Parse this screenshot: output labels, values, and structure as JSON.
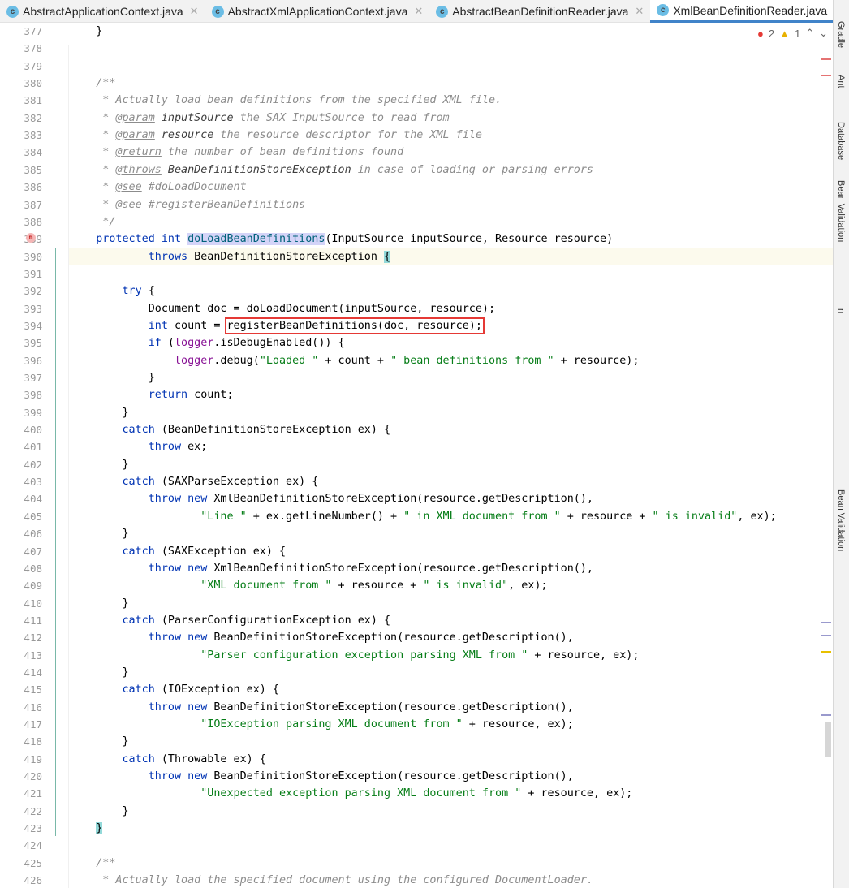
{
  "tabs": [
    {
      "label": "AbstractApplicationContext.java",
      "active": false
    },
    {
      "label": "AbstractXmlApplicationContext.java",
      "active": false
    },
    {
      "label": "AbstractBeanDefinitionReader.java",
      "active": false
    },
    {
      "label": "XmlBeanDefinitionReader.java",
      "active": true
    }
  ],
  "inspections": {
    "errors": "2",
    "warnings": "1"
  },
  "tool_windows": [
    "Gradle",
    "Ant",
    "Database",
    "Bean Validation",
    "n",
    "Bean Validation"
  ],
  "colors": {
    "keyword": "#0033b3",
    "string": "#067d17",
    "comment": "#8c8c8c",
    "field": "#871094",
    "highlight_box": "#e53935"
  },
  "current_line": 390,
  "boxed_line": 394,
  "lines": [
    {
      "n": "377",
      "t": [
        [
          "p",
          "    }"
        ]
      ]
    },
    {
      "n": "378",
      "t": []
    },
    {
      "n": "379",
      "t": []
    },
    {
      "n": "380",
      "t": [
        [
          "c",
          "    /**"
        ]
      ]
    },
    {
      "n": "381",
      "t": [
        [
          "c",
          "     * Actually load bean definitions from the specified XML file."
        ]
      ]
    },
    {
      "n": "382",
      "t": [
        [
          "c",
          "     * "
        ],
        [
          "ct",
          "@param"
        ],
        [
          "cb",
          " inputSource"
        ],
        [
          "c",
          " the SAX InputSource to read from"
        ]
      ]
    },
    {
      "n": "383",
      "t": [
        [
          "c",
          "     * "
        ],
        [
          "ct",
          "@param"
        ],
        [
          "cb",
          " resource"
        ],
        [
          "c",
          " the resource descriptor for the XML file"
        ]
      ]
    },
    {
      "n": "384",
      "t": [
        [
          "c",
          "     * "
        ],
        [
          "ct",
          "@return"
        ],
        [
          "c",
          " the number of bean definitions found"
        ]
      ]
    },
    {
      "n": "385",
      "t": [
        [
          "c",
          "     * "
        ],
        [
          "ct",
          "@throws"
        ],
        [
          "cb",
          " BeanDefinitionStoreException"
        ],
        [
          "c",
          " in case of loading or parsing errors"
        ]
      ]
    },
    {
      "n": "386",
      "t": [
        [
          "c",
          "     * "
        ],
        [
          "ct",
          "@see"
        ],
        [
          "c",
          " #doLoadDocument"
        ]
      ]
    },
    {
      "n": "387",
      "t": [
        [
          "c",
          "     * "
        ],
        [
          "ct",
          "@see"
        ],
        [
          "c",
          " #registerBeanDefinitions"
        ]
      ]
    },
    {
      "n": "388",
      "t": [
        [
          "c",
          "     */"
        ]
      ]
    },
    {
      "n": "389",
      "t": [
        [
          "k",
          "    protected int "
        ],
        [
          "m",
          "doLoadBeanDefinitions"
        ],
        [
          "p",
          "(InputSource inputSource, Resource resource)"
        ]
      ]
    },
    {
      "n": "390",
      "t": [
        [
          "k",
          "            throws"
        ],
        [
          "p",
          " BeanDefinitionStoreException "
        ],
        [
          "br",
          "{"
        ]
      ]
    },
    {
      "n": "391",
      "t": []
    },
    {
      "n": "392",
      "t": [
        [
          "k",
          "        try"
        ],
        [
          "p",
          " {"
        ]
      ]
    },
    {
      "n": "393",
      "t": [
        [
          "p",
          "            Document doc = doLoadDocument(inputSource, resource);"
        ]
      ]
    },
    {
      "n": "394",
      "t": [
        [
          "k",
          "            int"
        ],
        [
          "p",
          " count = "
        ],
        [
          "x",
          "registerBeanDefinitions(doc, resource);"
        ]
      ]
    },
    {
      "n": "395",
      "t": [
        [
          "k",
          "            if"
        ],
        [
          "p",
          " ("
        ],
        [
          "f",
          "logger"
        ],
        [
          "p",
          ".isDebugEnabled()) {"
        ]
      ]
    },
    {
      "n": "396",
      "t": [
        [
          "f",
          "                logger"
        ],
        [
          "p",
          ".debug("
        ],
        [
          "s",
          "\"Loaded \""
        ],
        [
          "p",
          " + count + "
        ],
        [
          "s",
          "\" bean definitions from \""
        ],
        [
          "p",
          " + resource);"
        ]
      ]
    },
    {
      "n": "397",
      "t": [
        [
          "p",
          "            }"
        ]
      ]
    },
    {
      "n": "398",
      "t": [
        [
          "k",
          "            return"
        ],
        [
          "p",
          " count;"
        ]
      ]
    },
    {
      "n": "399",
      "t": [
        [
          "p",
          "        }"
        ]
      ]
    },
    {
      "n": "400",
      "t": [
        [
          "k",
          "        catch"
        ],
        [
          "p",
          " (BeanDefinitionStoreException ex) {"
        ]
      ]
    },
    {
      "n": "401",
      "t": [
        [
          "k",
          "            throw"
        ],
        [
          "p",
          " ex;"
        ]
      ]
    },
    {
      "n": "402",
      "t": [
        [
          "p",
          "        }"
        ]
      ]
    },
    {
      "n": "403",
      "t": [
        [
          "k",
          "        catch"
        ],
        [
          "p",
          " (SAXParseException ex) {"
        ]
      ]
    },
    {
      "n": "404",
      "t": [
        [
          "k",
          "            throw new"
        ],
        [
          "p",
          " XmlBeanDefinitionStoreException(resource.getDescription(),"
        ]
      ]
    },
    {
      "n": "405",
      "t": [
        [
          "s",
          "                    \"Line \""
        ],
        [
          "p",
          " + ex.getLineNumber() + "
        ],
        [
          "s",
          "\" in XML document from \""
        ],
        [
          "p",
          " + resource + "
        ],
        [
          "s",
          "\" is invalid\""
        ],
        [
          "p",
          ", ex);"
        ]
      ]
    },
    {
      "n": "406",
      "t": [
        [
          "p",
          "        }"
        ]
      ]
    },
    {
      "n": "407",
      "t": [
        [
          "k",
          "        catch"
        ],
        [
          "p",
          " (SAXException ex) {"
        ]
      ]
    },
    {
      "n": "408",
      "t": [
        [
          "k",
          "            throw new"
        ],
        [
          "p",
          " XmlBeanDefinitionStoreException(resource.getDescription(),"
        ]
      ]
    },
    {
      "n": "409",
      "t": [
        [
          "s",
          "                    \"XML document from \""
        ],
        [
          "p",
          " + resource + "
        ],
        [
          "s",
          "\" is invalid\""
        ],
        [
          "p",
          ", ex);"
        ]
      ]
    },
    {
      "n": "410",
      "t": [
        [
          "p",
          "        }"
        ]
      ]
    },
    {
      "n": "411",
      "t": [
        [
          "k",
          "        catch"
        ],
        [
          "p",
          " (ParserConfigurationException ex) {"
        ]
      ]
    },
    {
      "n": "412",
      "t": [
        [
          "k",
          "            throw new"
        ],
        [
          "p",
          " BeanDefinitionStoreException(resource.getDescription(),"
        ]
      ]
    },
    {
      "n": "413",
      "t": [
        [
          "s",
          "                    \"Parser configuration exception parsing XML from \""
        ],
        [
          "p",
          " + resource, ex);"
        ]
      ]
    },
    {
      "n": "414",
      "t": [
        [
          "p",
          "        }"
        ]
      ]
    },
    {
      "n": "415",
      "t": [
        [
          "k",
          "        catch"
        ],
        [
          "p",
          " (IOException ex) {"
        ]
      ]
    },
    {
      "n": "416",
      "t": [
        [
          "k",
          "            throw new"
        ],
        [
          "p",
          " BeanDefinitionStoreException(resource.getDescription(),"
        ]
      ]
    },
    {
      "n": "417",
      "t": [
        [
          "s",
          "                    \"IOException parsing XML document from \""
        ],
        [
          "p",
          " + resource, ex);"
        ]
      ]
    },
    {
      "n": "418",
      "t": [
        [
          "p",
          "        }"
        ]
      ]
    },
    {
      "n": "419",
      "t": [
        [
          "k",
          "        catch"
        ],
        [
          "p",
          " (Throwable ex) {"
        ]
      ]
    },
    {
      "n": "420",
      "t": [
        [
          "k",
          "            throw new"
        ],
        [
          "p",
          " BeanDefinitionStoreException(resource.getDescription(),"
        ]
      ]
    },
    {
      "n": "421",
      "t": [
        [
          "s",
          "                    \"Unexpected exception parsing XML document from \""
        ],
        [
          "p",
          " + resource, ex);"
        ]
      ]
    },
    {
      "n": "422",
      "t": [
        [
          "p",
          "        }"
        ]
      ]
    },
    {
      "n": "423",
      "t": [
        [
          "p",
          "    "
        ],
        [
          "br",
          "}"
        ]
      ]
    },
    {
      "n": "424",
      "t": []
    },
    {
      "n": "425",
      "t": [
        [
          "c",
          "    /**"
        ]
      ]
    },
    {
      "n": "426",
      "t": [
        [
          "c",
          "     * Actually load the specified document using the configured DocumentLoader."
        ]
      ]
    }
  ]
}
